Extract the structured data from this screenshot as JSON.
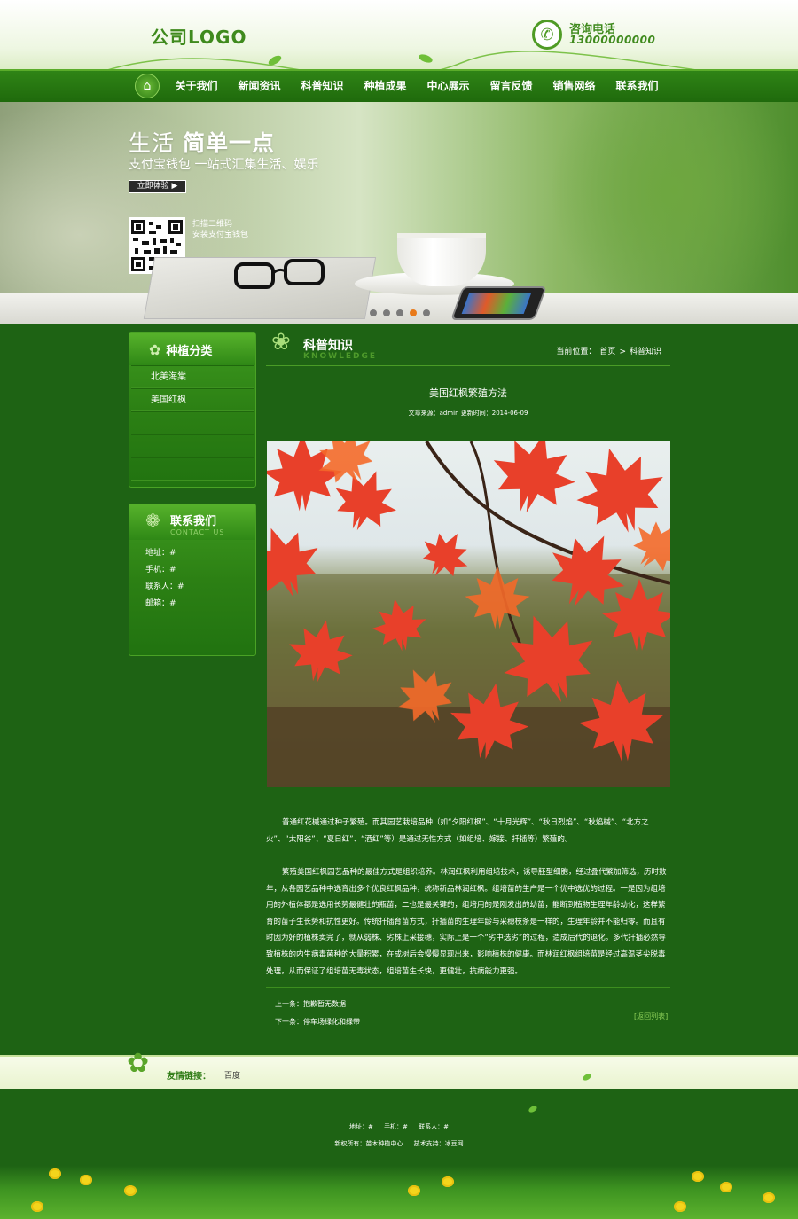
{
  "header": {
    "logo": "公司LOGO",
    "phone_label": "咨询电话",
    "phone_number": "13000000000"
  },
  "nav": {
    "home_icon": "home-icon",
    "items": [
      "关于我们",
      "新闻资讯",
      "科普知识",
      "种植成果",
      "中心展示",
      "留言反馈",
      "销售网络",
      "联系我们"
    ]
  },
  "banner": {
    "title_a": "生活",
    "title_b": "简单一点",
    "subtitle": "支付宝钱包  一站式汇集生活、娱乐",
    "button": "立即体验",
    "qr_caption_1": "扫描二维码",
    "qr_caption_2": "安装支付宝钱包",
    "slides": 5,
    "active_slide": 4
  },
  "sidebar": {
    "categories_title": "种植分类",
    "categories": [
      "北美海棠",
      "美国红枫"
    ],
    "contact_title": "联系我们",
    "contact_en": "CONTACT US",
    "contact_rows": [
      "地址：#",
      "手机：#",
      "联系人：#",
      "邮箱：#"
    ]
  },
  "content": {
    "section_title": "科普知识",
    "section_en": "KNOWLEDGE",
    "crumb_label": "当前位置：",
    "crumb_home": "首页",
    "crumb_sep": ">",
    "crumb_current": "科普知识",
    "article_title": "美国红枫繁殖方法",
    "article_meta": "文章来源：admin 更新时间：2014-06-09",
    "paragraph_1": "普通红花槭通过种子繁殖。而其园艺栽培品种（如“夕阳红枫”、“十月光辉”、“秋日烈焰”、“秋焰槭”、“北方之火”、“太阳谷”、“夏日红”、“酒红”等）是通过无性方式（如组培、嫁接、扦插等）繁殖的。",
    "paragraph_2": "繁殖美国红枫园艺品种的最佳方式是组织培养。林润红枫利用组培技术，诱导胚型细胞，经过叠代繁加筛选，历时数年，从各园艺品种中选育出多个优良红枫品种，统称新品林润红枫。组培苗的生产是一个优中选优的过程。一是因为组培用的外植体都是选用长势最健壮的瓶苗，二也是最关键的，组培用的是刚发出的幼苗，能断到植物生理年龄幼化，这样繁育的苗子生长势和抗性更好。传统扦插育苗方式，扦插苗的生理年龄与采穗枝条是一样的，生理年龄并不能归零。而且有时因为好的植株卖完了，就从弱株、劣株上采接穗，实际上是一个“劣中选劣”的过程，造成后代的退化。多代扦插必然导致植株的内生病毒菌种的大量积累，在成树后会慢慢显现出来，影响植株的健康。而林润红枫组培苗是经过高温茎尖脱毒处理，从而保证了组培苗无毒状态，组培苗生长快，更健壮，抗病能力更强。",
    "prev": "上一条：抱歉暂无数据",
    "next": "下一条：停车场绿化和绿带",
    "back": "[返回列表]"
  },
  "links": {
    "label": "友情链接：",
    "items": [
      "百度"
    ]
  },
  "footer": {
    "address": "地址：#",
    "mobile": "手机：#",
    "contact": "联系人：#",
    "copyright": "新权所有：苗木种植中心",
    "support": "技术支持：冰豆网"
  },
  "colors": {
    "page_bg": "#1e6314",
    "nav_bg": "#2f8416",
    "accent": "#e87a1a"
  }
}
